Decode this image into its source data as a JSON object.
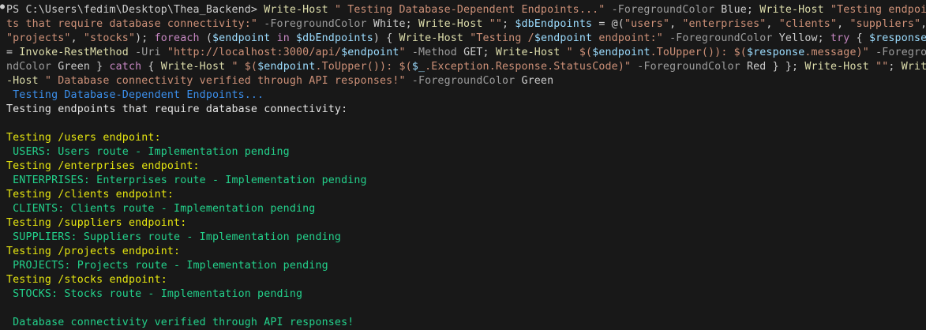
{
  "terminal": {
    "command_lines": [
      [
        {
          "t": "PS C:\\Users\\fedim\\Desktop\\Thea_Backend> ",
          "c": "prompt"
        },
        {
          "t": "Write-Host",
          "c": "cmd"
        },
        {
          "t": " ",
          "c": "plain"
        },
        {
          "t": "\" Testing Database-Dependent Endpoints...\"",
          "c": "str"
        },
        {
          "t": " -ForegroundColor ",
          "c": "param"
        },
        {
          "t": "Blue; ",
          "c": "plain"
        },
        {
          "t": "Write-Host",
          "c": "cmd"
        },
        {
          "t": " ",
          "c": "plain"
        },
        {
          "t": "\"Testing endpoin",
          "c": "str"
        }
      ],
      [
        {
          "t": "ts that require database connectivity:\"",
          "c": "str"
        },
        {
          "t": " -ForegroundColor ",
          "c": "param"
        },
        {
          "t": "White; ",
          "c": "plain"
        },
        {
          "t": "Write-Host",
          "c": "cmd"
        },
        {
          "t": " ",
          "c": "plain"
        },
        {
          "t": "\"\"",
          "c": "str"
        },
        {
          "t": "; ",
          "c": "plain"
        },
        {
          "t": "$dbEndpoints",
          "c": "var"
        },
        {
          "t": " = @(",
          "c": "plain"
        },
        {
          "t": "\"users\"",
          "c": "str"
        },
        {
          "t": ", ",
          "c": "plain"
        },
        {
          "t": "\"enterprises\"",
          "c": "str"
        },
        {
          "t": ", ",
          "c": "plain"
        },
        {
          "t": "\"clients\"",
          "c": "str"
        },
        {
          "t": ", ",
          "c": "plain"
        },
        {
          "t": "\"suppliers\"",
          "c": "str"
        },
        {
          "t": ",",
          "c": "plain"
        }
      ],
      [
        {
          "t": "\"projects\"",
          "c": "str"
        },
        {
          "t": ", ",
          "c": "plain"
        },
        {
          "t": "\"stocks\"",
          "c": "str"
        },
        {
          "t": "); ",
          "c": "plain"
        },
        {
          "t": "foreach",
          "c": "kw"
        },
        {
          "t": " (",
          "c": "plain"
        },
        {
          "t": "$endpoint",
          "c": "var"
        },
        {
          "t": " ",
          "c": "plain"
        },
        {
          "t": "in",
          "c": "kw"
        },
        {
          "t": " ",
          "c": "plain"
        },
        {
          "t": "$dbEndpoints",
          "c": "var"
        },
        {
          "t": ") { ",
          "c": "plain"
        },
        {
          "t": "Write-Host",
          "c": "cmd"
        },
        {
          "t": " ",
          "c": "plain"
        },
        {
          "t": "\"Testing /",
          "c": "str"
        },
        {
          "t": "$endpoint",
          "c": "var"
        },
        {
          "t": " endpoint:\"",
          "c": "str"
        },
        {
          "t": " -ForegroundColor ",
          "c": "param"
        },
        {
          "t": "Yellow; ",
          "c": "plain"
        },
        {
          "t": "try",
          "c": "kw"
        },
        {
          "t": " { ",
          "c": "plain"
        },
        {
          "t": "$response",
          "c": "var"
        }
      ],
      [
        {
          "t": "= ",
          "c": "plain"
        },
        {
          "t": "Invoke-RestMethod",
          "c": "cmd"
        },
        {
          "t": " -Uri ",
          "c": "param"
        },
        {
          "t": "\"http://localhost:3000/api/",
          "c": "str"
        },
        {
          "t": "$endpoint",
          "c": "var"
        },
        {
          "t": "\"",
          "c": "str"
        },
        {
          "t": " -Method ",
          "c": "param"
        },
        {
          "t": "GET; ",
          "c": "plain"
        },
        {
          "t": "Write-Host",
          "c": "cmd"
        },
        {
          "t": " ",
          "c": "plain"
        },
        {
          "t": "\" $(",
          "c": "str"
        },
        {
          "t": "$endpoint",
          "c": "var"
        },
        {
          "t": ".ToUpper()): $(",
          "c": "str"
        },
        {
          "t": "$response",
          "c": "var"
        },
        {
          "t": ".message)\"",
          "c": "str"
        },
        {
          "t": " -Foregrou",
          "c": "param"
        }
      ],
      [
        {
          "t": "ndColor ",
          "c": "param"
        },
        {
          "t": "Green } ",
          "c": "plain"
        },
        {
          "t": "catch",
          "c": "kw"
        },
        {
          "t": " { ",
          "c": "plain"
        },
        {
          "t": "Write-Host",
          "c": "cmd"
        },
        {
          "t": " ",
          "c": "plain"
        },
        {
          "t": "\" $(",
          "c": "str"
        },
        {
          "t": "$endpoint",
          "c": "var"
        },
        {
          "t": ".ToUpper()): $(",
          "c": "str"
        },
        {
          "t": "$_",
          "c": "var"
        },
        {
          "t": ".Exception.Response.StatusCode)\"",
          "c": "str"
        },
        {
          "t": " -ForegroundColor ",
          "c": "param"
        },
        {
          "t": "Red } }; ",
          "c": "plain"
        },
        {
          "t": "Write-Host",
          "c": "cmd"
        },
        {
          "t": " ",
          "c": "plain"
        },
        {
          "t": "\"\"",
          "c": "str"
        },
        {
          "t": "; ",
          "c": "plain"
        },
        {
          "t": "Write",
          "c": "cmd"
        }
      ],
      [
        {
          "t": "-Host",
          "c": "cmd"
        },
        {
          "t": " ",
          "c": "plain"
        },
        {
          "t": "\" Database connectivity verified through API responses!\"",
          "c": "str"
        },
        {
          "t": " -ForegroundColor ",
          "c": "param"
        },
        {
          "t": "Green",
          "c": "plain"
        }
      ]
    ],
    "output_lines": [
      {
        "t": " Testing Database-Dependent Endpoints...",
        "c": "blue"
      },
      {
        "t": "Testing endpoints that require database connectivity:",
        "c": "white"
      },
      {
        "t": "",
        "c": "white"
      },
      {
        "t": "Testing /users endpoint:",
        "c": "yellow"
      },
      {
        "t": " USERS: Users route - Implementation pending",
        "c": "green"
      },
      {
        "t": "Testing /enterprises endpoint:",
        "c": "yellow"
      },
      {
        "t": " ENTERPRISES: Enterprises route - Implementation pending",
        "c": "green"
      },
      {
        "t": "Testing /clients endpoint:",
        "c": "yellow"
      },
      {
        "t": " CLIENTS: Clients route - Implementation pending",
        "c": "green"
      },
      {
        "t": "Testing /suppliers endpoint:",
        "c": "yellow"
      },
      {
        "t": " SUPPLIERS: Suppliers route - Implementation pending",
        "c": "green"
      },
      {
        "t": "Testing /projects endpoint:",
        "c": "yellow"
      },
      {
        "t": " PROJECTS: Projects route - Implementation pending",
        "c": "green"
      },
      {
        "t": "Testing /stocks endpoint:",
        "c": "yellow"
      },
      {
        "t": " STOCKS: Stocks route - Implementation pending",
        "c": "green"
      },
      {
        "t": "",
        "c": "green"
      },
      {
        "t": " Database connectivity verified through API responses!",
        "c": "green"
      }
    ],
    "colors": {
      "background": "#181818",
      "string": "#ce9178",
      "command": "#dcdcaa",
      "variable": "#9cdcfe",
      "keyword": "#c586c0",
      "parameter": "#9d9d9d",
      "out_blue": "#3b8eea",
      "out_yellow": "#e5e510",
      "out_green": "#23d18b"
    }
  }
}
